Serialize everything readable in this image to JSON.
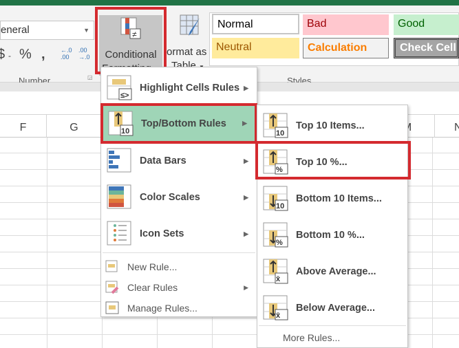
{
  "ribbon": {
    "number_format": "eneral",
    "number_symbols": {
      "currency": "$",
      "dash": "-",
      "percent": "%",
      "comma": ",",
      "inc_decimal": "←.0 .00",
      "dec_decimal": ".00 →.0"
    },
    "conditional_formatting": [
      "Conditional",
      "Formatting"
    ],
    "format_as_table": [
      "ormat as",
      "Table"
    ],
    "groups": {
      "number": "Number",
      "styles": "Styles"
    },
    "styles": [
      {
        "label": "Normal",
        "bg": "#ffffff",
        "color": "#000000"
      },
      {
        "label": "Bad",
        "bg": "#ffc7ce",
        "color": "#9c0006"
      },
      {
        "label": "Good",
        "bg": "#c6efce",
        "color": "#006100"
      },
      {
        "label": "Neutral",
        "bg": "#ffeb9c",
        "color": "#9c5700"
      },
      {
        "label": "Calculation",
        "bg": "#f2f2f2",
        "color": "#fa7d00"
      },
      {
        "label": "Check Cell",
        "bg": "#a5a5a5",
        "color": "#ffffff"
      }
    ]
  },
  "columns": [
    "F",
    "G",
    "M",
    "N"
  ],
  "menu": {
    "items": [
      "Highlight Cells Rules",
      "Top/Bottom Rules",
      "Data Bars",
      "Color Scales",
      "Icon Sets"
    ],
    "small_items": [
      "New Rule...",
      "Clear Rules",
      "Manage Rules..."
    ]
  },
  "submenu": {
    "items": [
      "Top 10 Items...",
      "Top 10 %...",
      "Bottom 10 Items...",
      "Bottom 10 %...",
      "Above Average...",
      "Below Average..."
    ],
    "badges": [
      "10",
      "%",
      "10",
      "%",
      "x̄",
      "x̄"
    ],
    "more": "More Rules..."
  },
  "colors": {
    "highlight": "#9fd5b7",
    "callout": "#d42a2f",
    "excel_green": "#217346"
  }
}
